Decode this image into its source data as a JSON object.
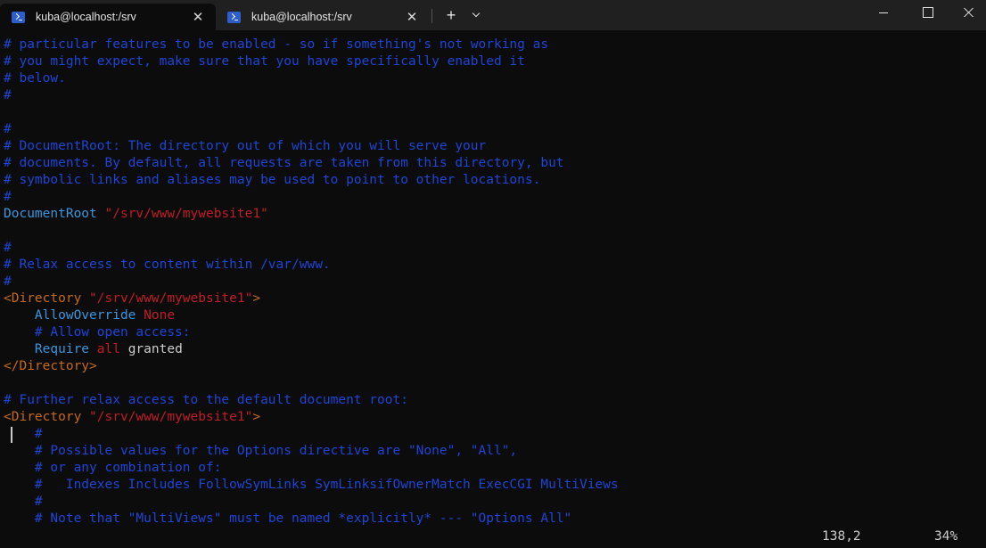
{
  "tabs": [
    {
      "title": "kuba@localhost:/srv",
      "icon": "powershell-icon",
      "active": true
    },
    {
      "title": "kuba@localhost:/srv",
      "icon": "powershell-icon",
      "active": false
    }
  ],
  "tab_controls": {
    "new_tab": "+",
    "close": "✕"
  },
  "colors": {
    "comment": "#1e45d6",
    "directive": "#3a96dd",
    "string": "#c01c28",
    "tag": "#c5691a",
    "text": "#cccccc",
    "background": "#0c0c0c"
  },
  "editor_lines": [
    [
      {
        "t": "# particular features to be enabled - so if something's not working as",
        "c": "comment"
      }
    ],
    [
      {
        "t": "# you might expect, make sure that you have specifically enabled it",
        "c": "comment"
      }
    ],
    [
      {
        "t": "# below.",
        "c": "comment"
      }
    ],
    [
      {
        "t": "#",
        "c": "comment"
      }
    ],
    [],
    [
      {
        "t": "#",
        "c": "comment"
      }
    ],
    [
      {
        "t": "# DocumentRoot: The directory out of which you will serve your",
        "c": "comment"
      }
    ],
    [
      {
        "t": "# documents. By default, all requests are taken from this directory, but",
        "c": "comment"
      }
    ],
    [
      {
        "t": "# symbolic links and aliases may be used to point to other locations.",
        "c": "comment"
      }
    ],
    [
      {
        "t": "#",
        "c": "comment"
      }
    ],
    [
      {
        "t": "DocumentRoot",
        "c": "ident"
      },
      {
        "t": " ",
        "c": "plain"
      },
      {
        "t": "\"/srv/www/mywebsite1\"",
        "c": "string"
      }
    ],
    [],
    [
      {
        "t": "#",
        "c": "comment"
      }
    ],
    [
      {
        "t": "# Relax access to content within /var/www.",
        "c": "comment"
      }
    ],
    [
      {
        "t": "#",
        "c": "comment"
      }
    ],
    [
      {
        "t": "<Directory ",
        "c": "tag"
      },
      {
        "t": "\"/srv/www/mywebsite1\"",
        "c": "string"
      },
      {
        "t": ">",
        "c": "tag"
      }
    ],
    [
      {
        "t": "    ",
        "c": "plain"
      },
      {
        "t": "AllowOverride",
        "c": "ident"
      },
      {
        "t": " ",
        "c": "plain"
      },
      {
        "t": "None",
        "c": "keyword"
      }
    ],
    [
      {
        "t": "    ",
        "c": "plain"
      },
      {
        "t": "# Allow open access:",
        "c": "comment"
      }
    ],
    [
      {
        "t": "    ",
        "c": "plain"
      },
      {
        "t": "Require",
        "c": "ident"
      },
      {
        "t": " ",
        "c": "plain"
      },
      {
        "t": "all",
        "c": "keyword"
      },
      {
        "t": " granted",
        "c": "plain"
      }
    ],
    [
      {
        "t": "</Directory>",
        "c": "tag"
      }
    ],
    [],
    [
      {
        "t": "# Further relax access to the default document root:",
        "c": "comment"
      }
    ],
    [
      {
        "t": "<Directory ",
        "c": "tag"
      },
      {
        "t": "\"/srv/www/mywebsite1\"",
        "c": "string"
      },
      {
        "t": ">",
        "c": "tag"
      }
    ],
    [
      {
        "t": "    ",
        "c": "plain"
      },
      {
        "t": "#",
        "c": "comment"
      }
    ],
    [
      {
        "t": "    ",
        "c": "plain"
      },
      {
        "t": "# Possible values for the Options directive are \"None\", \"All\",",
        "c": "comment"
      }
    ],
    [
      {
        "t": "    ",
        "c": "plain"
      },
      {
        "t": "# or any combination of:",
        "c": "comment"
      }
    ],
    [
      {
        "t": "    ",
        "c": "plain"
      },
      {
        "t": "#   Indexes Includes FollowSymLinks SymLinksifOwnerMatch ExecCGI MultiViews",
        "c": "comment"
      }
    ],
    [
      {
        "t": "    ",
        "c": "plain"
      },
      {
        "t": "#",
        "c": "comment"
      }
    ],
    [
      {
        "t": "    ",
        "c": "plain"
      },
      {
        "t": "# Note that \"MultiViews\" must be named *explicitly* --- \"Options All\"",
        "c": "comment"
      }
    ]
  ],
  "status": {
    "position": "138,2",
    "percent": "34%"
  }
}
